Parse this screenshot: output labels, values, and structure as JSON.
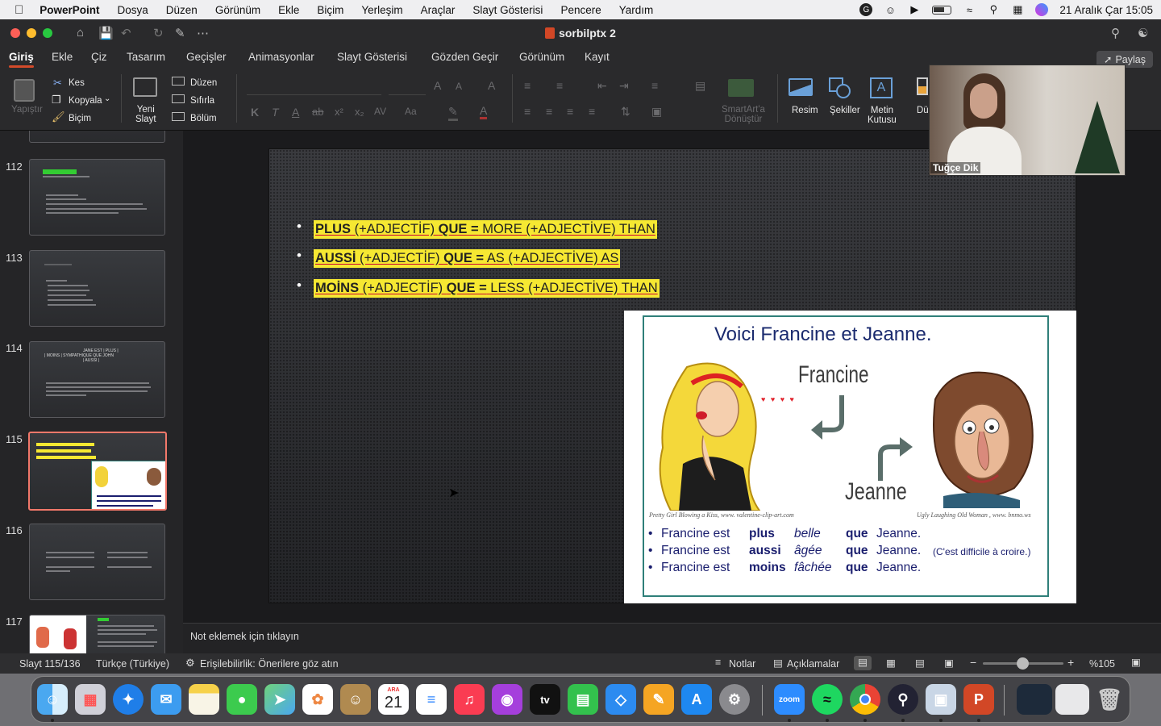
{
  "menubar": {
    "app": "PowerPoint",
    "items": [
      "Dosya",
      "Düzen",
      "Görünüm",
      "Ekle",
      "Biçim",
      "Yerleşim",
      "Araçlar",
      "Slayt Gösterisi",
      "Pencere",
      "Yardım"
    ],
    "datetime": "21 Aralık Çar  15:05"
  },
  "window": {
    "title": "sorbilptx 2"
  },
  "tabs": [
    "Giriş",
    "Ekle",
    "Çiz",
    "Tasarım",
    "Geçişler",
    "Animasyonlar",
    "Slayt Gösterisi",
    "Gözden Geçir",
    "Görünüm",
    "Kayıt"
  ],
  "share_label": "Paylaş",
  "ribbon": {
    "paste": "Yapıştır",
    "cut": "Kes",
    "copy": "Kopyala",
    "format": "Biçim",
    "new_slide": "Yeni\nSlayt",
    "layout": "Düzen",
    "reset": "Sıfırla",
    "section": "Bölüm",
    "smartart": "SmartArt'a\nDönüştür",
    "picture": "Resim",
    "shapes": "Şekiller",
    "textbox": "Metin\nKutusu",
    "arrange": "Dü"
  },
  "video": {
    "name": "Tuğçe Dik"
  },
  "thumbnails": [
    {
      "num": "112"
    },
    {
      "num": "113"
    },
    {
      "num": "114"
    },
    {
      "num": "115"
    },
    {
      "num": "116"
    },
    {
      "num": "117"
    }
  ],
  "thumb114_lines": [
    "JANE  EST  | PLUS |",
    "| MOINS | SYMPATHIQUE QUE JOHN",
    "| AUSSI |"
  ],
  "slide": {
    "bullets": [
      {
        "bold": "PLUS",
        "rest": " (+ADJECTİF) ",
        "bold2": "QUE =",
        "end": " MORE (+ADJECTİVE) THAN"
      },
      {
        "bold": "AUSSİ",
        "rest": " (+ADJECTİF) ",
        "bold2": "QUE =",
        "end": " AS (+ADJECTİVE) AS"
      },
      {
        "bold": "MOİNS",
        "rest": " (+ADJECTİF) ",
        "bold2": "QUE =",
        "end": " LESS (+ADJECTİVE) THAN"
      }
    ],
    "picture": {
      "title": "Voici Francine et Jeanne.",
      "label_francine": "Francine",
      "label_jeanne": "Jeanne",
      "credit_left": "Pretty Girl Blowing a Kiss, www. valentine-clip-art.com",
      "credit_right": "Ugly Laughing Old Woman , www. bnmo.ws",
      "rows": [
        {
          "subj": "Francine est",
          "adv": "plus",
          "adj": "belle",
          "que": "que",
          "obj": "Jeanne.",
          "note": ""
        },
        {
          "subj": "Francine est",
          "adv": "aussi",
          "adj": "âgée",
          "que": "que",
          "obj": "Jeanne.",
          "note": "(C'est difficile à croire.)"
        },
        {
          "subj": "Francine est",
          "adv": "moins",
          "adj": "fâchée",
          "que": "que",
          "obj": "Jeanne.",
          "note": ""
        }
      ]
    }
  },
  "notes_placeholder": "Not eklemek için tıklayın",
  "status": {
    "slide_count": "Slayt 115/136",
    "language": "Türkçe (Türkiye)",
    "accessibility": "Erişilebilirlik: Önerilere göz atın",
    "notes": "Notlar",
    "comments": "Açıklamalar",
    "zoom": "%105"
  },
  "dock": {
    "calendar_month": "ARA",
    "calendar_day": "21",
    "zoom_label": "zoom"
  },
  "colors": {
    "accent": "#d34a2a",
    "highlight": "#f6e832",
    "frame": "#2f7f79"
  }
}
